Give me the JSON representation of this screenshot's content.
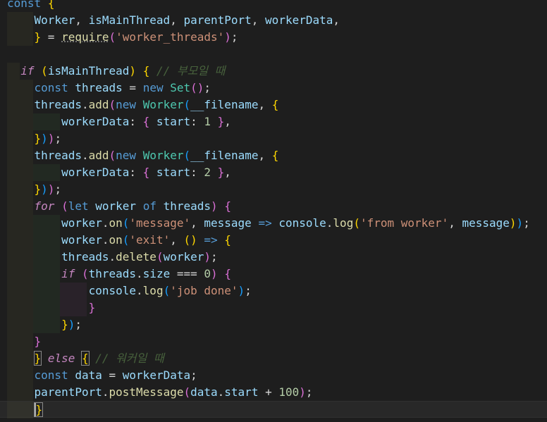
{
  "editor": {
    "lines": [
      [
        {
          "t": "const",
          "c": "k"
        },
        {
          "t": " ",
          "c": "p"
        },
        {
          "t": "{",
          "c": "b1"
        }
      ],
      [
        {
          "t": "    "
        },
        {
          "t": "Worker",
          "c": "v"
        },
        {
          "t": ", ",
          "c": "p"
        },
        {
          "t": "isMainThread",
          "c": "v"
        },
        {
          "t": ", ",
          "c": "p"
        },
        {
          "t": "parentPort",
          "c": "v"
        },
        {
          "t": ", ",
          "c": "p"
        },
        {
          "t": "workerData",
          "c": "v"
        },
        {
          "t": ",",
          "c": "p"
        }
      ],
      [
        {
          "t": "    "
        },
        {
          "t": "}",
          "c": "b1"
        },
        {
          "t": " = ",
          "c": "p"
        },
        {
          "t": "require",
          "c": "f ul"
        },
        {
          "t": "(",
          "c": "b2"
        },
        {
          "t": "'worker_threads'",
          "c": "s"
        },
        {
          "t": ")",
          "c": "b2"
        },
        {
          "t": ";",
          "c": "p"
        }
      ],
      [],
      [
        {
          "t": "  "
        },
        {
          "t": "if",
          "c": "c"
        },
        {
          "t": " ",
          "c": "p"
        },
        {
          "t": "(",
          "c": "b1"
        },
        {
          "t": "isMainThread",
          "c": "v"
        },
        {
          "t": ")",
          "c": "b1"
        },
        {
          "t": " ",
          "c": "p"
        },
        {
          "t": "{",
          "c": "b1"
        },
        {
          "t": " // 부모일 때",
          "c": "cm"
        }
      ],
      [
        {
          "t": "    "
        },
        {
          "t": "const",
          "c": "k"
        },
        {
          "t": " ",
          "c": "p"
        },
        {
          "t": "threads",
          "c": "v"
        },
        {
          "t": " = ",
          "c": "p"
        },
        {
          "t": "new",
          "c": "k"
        },
        {
          "t": " ",
          "c": "p"
        },
        {
          "t": "Set",
          "c": "t"
        },
        {
          "t": "()",
          "c": "b2"
        },
        {
          "t": ";",
          "c": "p"
        }
      ],
      [
        {
          "t": "    "
        },
        {
          "t": "threads",
          "c": "v"
        },
        {
          "t": ".",
          "c": "p"
        },
        {
          "t": "add",
          "c": "f"
        },
        {
          "t": "(",
          "c": "b2"
        },
        {
          "t": "new",
          "c": "k"
        },
        {
          "t": " ",
          "c": "p"
        },
        {
          "t": "Worker",
          "c": "t"
        },
        {
          "t": "(",
          "c": "b3"
        },
        {
          "t": "__filename",
          "c": "v"
        },
        {
          "t": ", ",
          "c": "p"
        },
        {
          "t": "{",
          "c": "b1"
        }
      ],
      [
        {
          "t": "        "
        },
        {
          "t": "workerData",
          "c": "v"
        },
        {
          "t": ": ",
          "c": "p"
        },
        {
          "t": "{",
          "c": "b2"
        },
        {
          "t": " start",
          "c": "v"
        },
        {
          "t": ": ",
          "c": "p"
        },
        {
          "t": "1",
          "c": "n"
        },
        {
          "t": " ",
          "c": "p"
        },
        {
          "t": "}",
          "c": "b2"
        },
        {
          "t": ",",
          "c": "p"
        }
      ],
      [
        {
          "t": "    "
        },
        {
          "t": "}",
          "c": "b1"
        },
        {
          "t": ")",
          "c": "b3"
        },
        {
          "t": ")",
          "c": "b2"
        },
        {
          "t": ";",
          "c": "p"
        }
      ],
      [
        {
          "t": "    "
        },
        {
          "t": "threads",
          "c": "v"
        },
        {
          "t": ".",
          "c": "p"
        },
        {
          "t": "add",
          "c": "f"
        },
        {
          "t": "(",
          "c": "b2"
        },
        {
          "t": "new",
          "c": "k"
        },
        {
          "t": " ",
          "c": "p"
        },
        {
          "t": "Worker",
          "c": "t"
        },
        {
          "t": "(",
          "c": "b3"
        },
        {
          "t": "__filename",
          "c": "v"
        },
        {
          "t": ", ",
          "c": "p"
        },
        {
          "t": "{",
          "c": "b1"
        }
      ],
      [
        {
          "t": "        "
        },
        {
          "t": "workerData",
          "c": "v"
        },
        {
          "t": ": ",
          "c": "p"
        },
        {
          "t": "{",
          "c": "b2"
        },
        {
          "t": " start",
          "c": "v"
        },
        {
          "t": ": ",
          "c": "p"
        },
        {
          "t": "2",
          "c": "n"
        },
        {
          "t": " ",
          "c": "p"
        },
        {
          "t": "}",
          "c": "b2"
        },
        {
          "t": ",",
          "c": "p"
        }
      ],
      [
        {
          "t": "    "
        },
        {
          "t": "}",
          "c": "b1"
        },
        {
          "t": ")",
          "c": "b3"
        },
        {
          "t": ")",
          "c": "b2"
        },
        {
          "t": ";",
          "c": "p"
        }
      ],
      [
        {
          "t": "    "
        },
        {
          "t": "for",
          "c": "c"
        },
        {
          "t": " ",
          "c": "p"
        },
        {
          "t": "(",
          "c": "b2"
        },
        {
          "t": "let",
          "c": "k"
        },
        {
          "t": " ",
          "c": "p"
        },
        {
          "t": "worker",
          "c": "v"
        },
        {
          "t": " ",
          "c": "p"
        },
        {
          "t": "of",
          "c": "k"
        },
        {
          "t": " ",
          "c": "p"
        },
        {
          "t": "threads",
          "c": "v"
        },
        {
          "t": ")",
          "c": "b2"
        },
        {
          "t": " ",
          "c": "p"
        },
        {
          "t": "{",
          "c": "b2"
        }
      ],
      [
        {
          "t": "        "
        },
        {
          "t": "worker",
          "c": "v"
        },
        {
          "t": ".",
          "c": "p"
        },
        {
          "t": "on",
          "c": "f"
        },
        {
          "t": "(",
          "c": "b3"
        },
        {
          "t": "'message'",
          "c": "s"
        },
        {
          "t": ", ",
          "c": "p"
        },
        {
          "t": "message",
          "c": "v"
        },
        {
          "t": " => ",
          "c": "k"
        },
        {
          "t": "console",
          "c": "v"
        },
        {
          "t": ".",
          "c": "p"
        },
        {
          "t": "log",
          "c": "f"
        },
        {
          "t": "(",
          "c": "b1"
        },
        {
          "t": "'from worker'",
          "c": "s"
        },
        {
          "t": ", ",
          "c": "p"
        },
        {
          "t": "message",
          "c": "v"
        },
        {
          "t": ")",
          "c": "b1"
        },
        {
          "t": ")",
          "c": "b3"
        },
        {
          "t": ";",
          "c": "p"
        }
      ],
      [
        {
          "t": "        "
        },
        {
          "t": "worker",
          "c": "v"
        },
        {
          "t": ".",
          "c": "p"
        },
        {
          "t": "on",
          "c": "f"
        },
        {
          "t": "(",
          "c": "b3"
        },
        {
          "t": "'exit'",
          "c": "s"
        },
        {
          "t": ", ",
          "c": "p"
        },
        {
          "t": "()",
          "c": "b1"
        },
        {
          "t": " => ",
          "c": "k"
        },
        {
          "t": "{",
          "c": "b1"
        }
      ],
      [
        {
          "t": "        "
        },
        {
          "t": "threads",
          "c": "v"
        },
        {
          "t": ".",
          "c": "p"
        },
        {
          "t": "delete",
          "c": "f"
        },
        {
          "t": "(",
          "c": "b2"
        },
        {
          "t": "worker",
          "c": "v"
        },
        {
          "t": ")",
          "c": "b2"
        },
        {
          "t": ";",
          "c": "p"
        }
      ],
      [
        {
          "t": "        "
        },
        {
          "t": "if",
          "c": "c"
        },
        {
          "t": " ",
          "c": "p"
        },
        {
          "t": "(",
          "c": "b2"
        },
        {
          "t": "threads",
          "c": "v"
        },
        {
          "t": ".",
          "c": "p"
        },
        {
          "t": "size",
          "c": "v"
        },
        {
          "t": " === ",
          "c": "p"
        },
        {
          "t": "0",
          "c": "n"
        },
        {
          "t": ")",
          "c": "b2"
        },
        {
          "t": " ",
          "c": "p"
        },
        {
          "t": "{",
          "c": "b2"
        }
      ],
      [
        {
          "t": "            "
        },
        {
          "t": "console",
          "c": "v"
        },
        {
          "t": ".",
          "c": "p"
        },
        {
          "t": "log",
          "c": "f"
        },
        {
          "t": "(",
          "c": "b3"
        },
        {
          "t": "'job done'",
          "c": "s"
        },
        {
          "t": ")",
          "c": "b3"
        },
        {
          "t": ";",
          "c": "p"
        }
      ],
      [
        {
          "t": "            "
        },
        {
          "t": "}",
          "c": "b2"
        }
      ],
      [
        {
          "t": "        "
        },
        {
          "t": "}",
          "c": "b1"
        },
        {
          "t": ")",
          "c": "b3"
        },
        {
          "t": ";",
          "c": "p"
        }
      ],
      [
        {
          "t": "    "
        },
        {
          "t": "}",
          "c": "b2"
        }
      ],
      [
        {
          "t": "    "
        },
        {
          "t": "}",
          "c": "b1 bm"
        },
        {
          "t": " ",
          "c": "p"
        },
        {
          "t": "else",
          "c": "c"
        },
        {
          "t": " ",
          "c": "p"
        },
        {
          "t": "{",
          "c": "b1 bm"
        },
        {
          "t": " // 워커일 때",
          "c": "cm"
        }
      ],
      [
        {
          "t": "    "
        },
        {
          "t": "const",
          "c": "k"
        },
        {
          "t": " ",
          "c": "p"
        },
        {
          "t": "data",
          "c": "v"
        },
        {
          "t": " = ",
          "c": "p"
        },
        {
          "t": "workerData",
          "c": "v"
        },
        {
          "t": ";",
          "c": "p"
        }
      ],
      [
        {
          "t": "    "
        },
        {
          "t": "parentPort",
          "c": "v"
        },
        {
          "t": ".",
          "c": "p"
        },
        {
          "t": "postMessage",
          "c": "f"
        },
        {
          "t": "(",
          "c": "b2"
        },
        {
          "t": "data",
          "c": "v"
        },
        {
          "t": ".",
          "c": "p"
        },
        {
          "t": "start",
          "c": "v"
        },
        {
          "t": " + ",
          "c": "p"
        },
        {
          "t": "100",
          "c": "n"
        },
        {
          "t": ")",
          "c": "b2"
        },
        {
          "t": ";",
          "c": "p"
        }
      ],
      [
        {
          "t": "    "
        },
        {
          "t": "}",
          "c": "b1 bm caret"
        }
      ]
    ]
  }
}
